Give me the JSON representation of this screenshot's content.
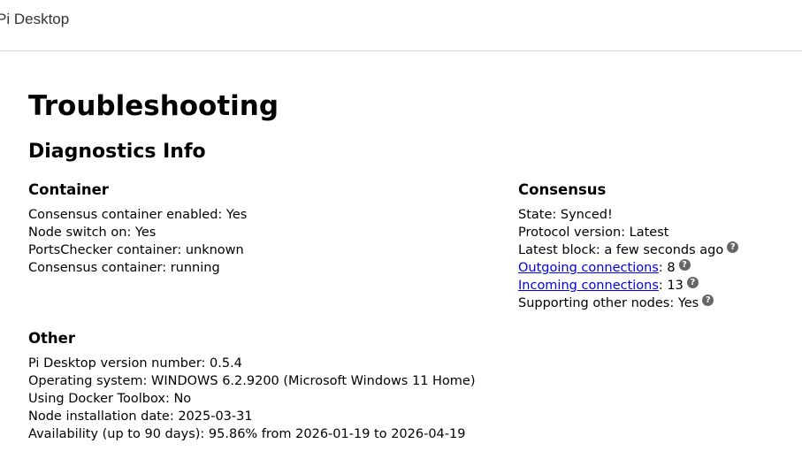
{
  "app": {
    "title": "Pi Desktop"
  },
  "page": {
    "title": "Troubleshooting",
    "section_title": "Diagnostics Info"
  },
  "container": {
    "title": "Container",
    "lines": [
      "Consensus container enabled: Yes",
      "Node switch on: Yes",
      "PortsChecker container: unknown",
      "Consensus container: running"
    ]
  },
  "consensus": {
    "title": "Consensus",
    "state": "State: Synced!",
    "protocol": "Protocol version: Latest",
    "latest_block": "Latest block: a few seconds ago",
    "outgoing": {
      "link": "Outgoing connections",
      "value": ": 8"
    },
    "incoming": {
      "link": "Incoming connections",
      "value": ": 13"
    },
    "supporting": "Supporting other nodes: Yes"
  },
  "other": {
    "title": "Other",
    "lines": [
      "Pi Desktop version number: 0.5.4",
      "Operating system: WINDOWS 6.2.9200 (Microsoft Windows 11 Home)",
      "Using Docker Toolbox: No",
      "Node installation date: 2025-03-31",
      "Availability (up to 90 days): 95.86% from 2026-01-19 to 2026-04-19"
    ]
  },
  "icons": {
    "help": "?"
  }
}
